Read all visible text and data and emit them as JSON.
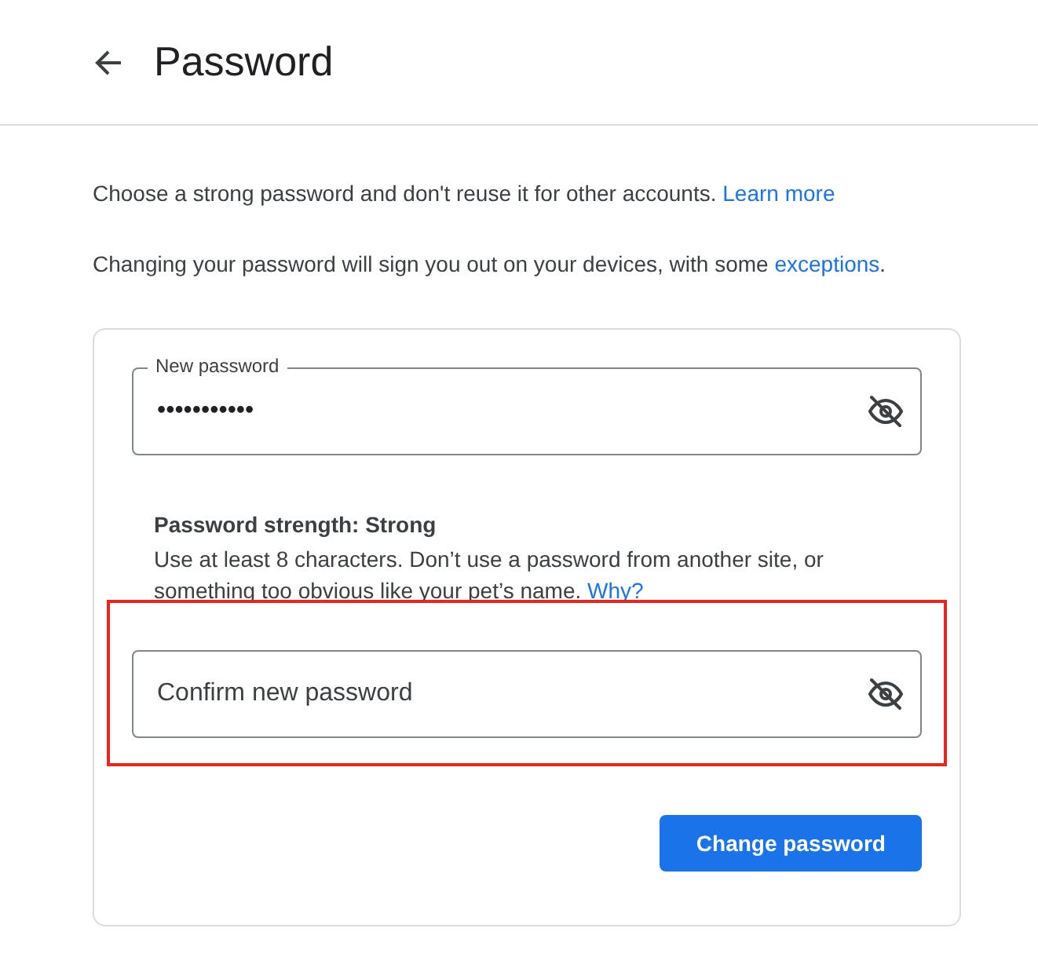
{
  "header": {
    "title": "Password"
  },
  "intro": {
    "text": "Choose a strong password and don't reuse it for other accounts.",
    "link": "Learn more"
  },
  "notice": {
    "text": "Changing your password will sign you out on your devices, with some",
    "link": "exceptions",
    "end": "."
  },
  "new_password": {
    "label": "New password",
    "value": "•••••••••••"
  },
  "strength": {
    "title": "Password strength: Strong",
    "hint": "Use at least 8 characters. Don’t use a password from another site, or something too obvious like your pet’s name.",
    "link": "Why?"
  },
  "confirm_password": {
    "placeholder": "Confirm new password",
    "highlighted": true
  },
  "button": "Change password"
}
